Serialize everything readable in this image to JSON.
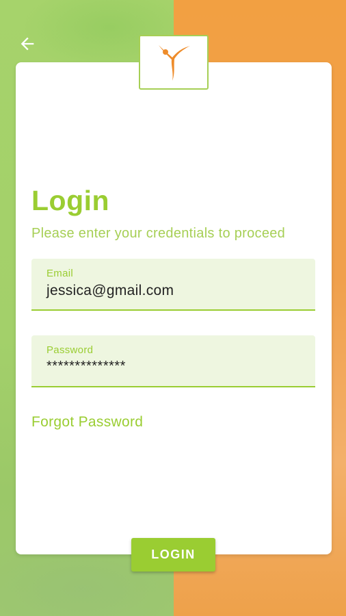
{
  "nav": {
    "back_icon": "arrow-left-icon"
  },
  "logo": {
    "icon": "person-figure-logo"
  },
  "login": {
    "title": "Login",
    "subtitle": "Please enter your credentials to proceed",
    "email_label": "Email",
    "email_value": "jessica@gmail.com",
    "password_label": "Password",
    "password_value": "**************",
    "forgot_label": "Forgot Password",
    "submit_label": "LOGIN"
  },
  "colors": {
    "accent_green": "#9acd32",
    "field_background": "#eef6e0",
    "background_left": "#a6d36b",
    "background_right": "#f2a042",
    "logo_orange": "#ee8c2b"
  }
}
